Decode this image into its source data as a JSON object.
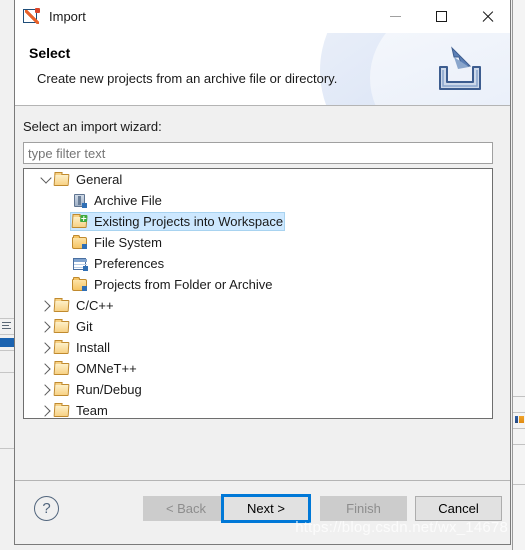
{
  "window": {
    "title": "Import",
    "app_icon": "import-pencil-icon",
    "controls": {
      "minimize": "minimize-icon",
      "maximize": "maximize-icon",
      "close": "close-icon"
    }
  },
  "banner": {
    "title": "Select",
    "description": "Create new projects from an archive file or directory.",
    "icon": "import-tray-arrow-icon"
  },
  "main": {
    "prompt": "Select an import wizard:",
    "filter": {
      "value": "",
      "placeholder": "type filter text"
    },
    "tree": [
      {
        "label": "General",
        "depth": 0,
        "expanded": true,
        "icon": "folder-open-icon",
        "selected": false
      },
      {
        "label": "Archive File",
        "depth": 1,
        "expanded": null,
        "icon": "archive-file-icon",
        "selected": false
      },
      {
        "label": "Existing Projects into Workspace",
        "depth": 1,
        "expanded": null,
        "icon": "folder-import-icon",
        "selected": true
      },
      {
        "label": "File System",
        "depth": 1,
        "expanded": null,
        "icon": "folder-icon",
        "selected": false
      },
      {
        "label": "Preferences",
        "depth": 1,
        "expanded": null,
        "icon": "preferences-icon",
        "selected": false
      },
      {
        "label": "Projects from Folder or Archive",
        "depth": 1,
        "expanded": null,
        "icon": "folder-icon",
        "selected": false
      },
      {
        "label": "C/C++",
        "depth": 0,
        "expanded": false,
        "icon": "folder-open-icon",
        "selected": false
      },
      {
        "label": "Git",
        "depth": 0,
        "expanded": false,
        "icon": "folder-open-icon",
        "selected": false
      },
      {
        "label": "Install",
        "depth": 0,
        "expanded": false,
        "icon": "folder-open-icon",
        "selected": false
      },
      {
        "label": "OMNeT++",
        "depth": 0,
        "expanded": false,
        "icon": "folder-open-icon",
        "selected": false
      },
      {
        "label": "Run/Debug",
        "depth": 0,
        "expanded": false,
        "icon": "folder-open-icon",
        "selected": false
      },
      {
        "label": "Team",
        "depth": 0,
        "expanded": false,
        "icon": "folder-open-icon",
        "selected": false
      }
    ]
  },
  "buttons": {
    "help": "?",
    "back": "< Back",
    "next": "Next >",
    "finish": "Finish",
    "cancel": "Cancel"
  },
  "colors": {
    "focus_ring": "#0078d7",
    "selection": "#cde8ff",
    "folder": "#f6c463",
    "dialog_bg": "#f0f0f0"
  },
  "watermark": "https://blog.csdn.net/wx_14678"
}
